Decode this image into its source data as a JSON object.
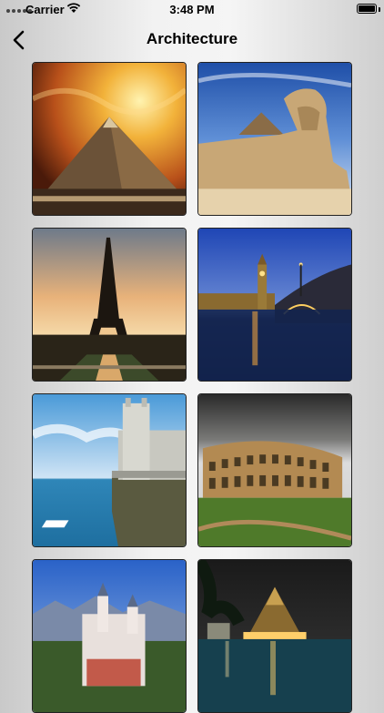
{
  "status_bar": {
    "carrier": "Carrier",
    "time": "3:48 PM"
  },
  "nav": {
    "title": "Architecture"
  },
  "photos": [
    {
      "subject": "pyramid"
    },
    {
      "subject": "sphinx"
    },
    {
      "subject": "eiffel-tower"
    },
    {
      "subject": "big-ben"
    },
    {
      "subject": "swallows-nest-castle"
    },
    {
      "subject": "colosseum"
    },
    {
      "subject": "neuschwanstein-castle"
    },
    {
      "subject": "sanctuary-of-truth"
    }
  ]
}
